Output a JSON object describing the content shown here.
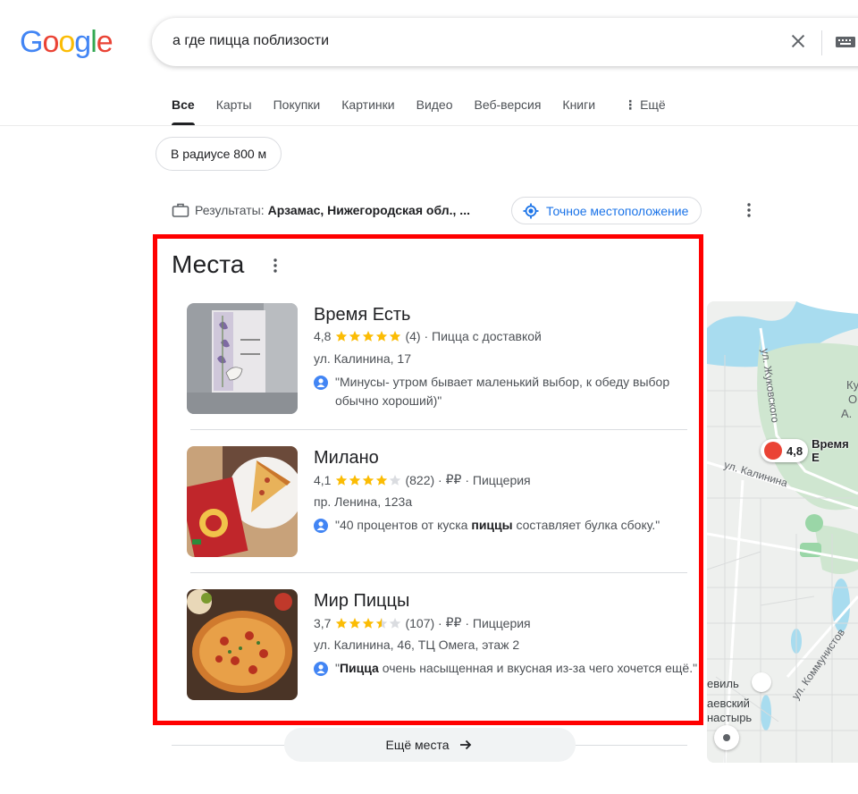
{
  "logo": {
    "text": [
      "G",
      "o",
      "o",
      "g",
      "l",
      "e"
    ],
    "colors": [
      "#4285f4",
      "#ea4335",
      "#fbbc05",
      "#4285f4",
      "#34a853",
      "#ea4335"
    ]
  },
  "search": {
    "query": "а где пицца поблизости"
  },
  "tabs": [
    {
      "label": "Все",
      "active": true
    },
    {
      "label": "Карты"
    },
    {
      "label": "Покупки"
    },
    {
      "label": "Картинки"
    },
    {
      "label": "Видео"
    },
    {
      "label": "Веб-версия"
    },
    {
      "label": "Книги"
    },
    {
      "label": "Ещё",
      "dots": "⋮"
    }
  ],
  "chip": {
    "label": "В радиусе 800 м"
  },
  "location": {
    "prefix": "Результаты:",
    "place": "Арзамас, Нижегородская обл., ...",
    "precise_label": "Точное местоположение"
  },
  "places": {
    "title": "Места",
    "items": [
      {
        "name": "Время Есть",
        "rating": "4,8",
        "stars": 5,
        "count": "(4)",
        "price": "",
        "category": "Пицца с доставкой",
        "address": "ул. Калинина, 17",
        "review_parts": [
          "\"Минусы- утром бывает маленький выбор, к обеду выбор обычно хороший)\""
        ]
      },
      {
        "name": "Милано",
        "rating": "4,1",
        "stars": 4,
        "count": "(822)",
        "price": "₽₽",
        "category": "Пиццерия",
        "address": "пр. Ленина, 123а",
        "review_before": "\"40 процентов от куска ",
        "review_bold": "пиццы",
        "review_after": " составляет булка сбоку.\""
      },
      {
        "name": "Мир Пиццы",
        "rating": "3,7",
        "stars": 3.5,
        "count": "(107)",
        "price": "₽₽",
        "category": "Пиццерия",
        "address": "ул. Калинина, 46, ТЦ Омега, этаж 2",
        "review_before": "\"",
        "review_bold": "Пицца",
        "review_after": " очень насыщенная и вкусная из-за чего хочется ещё.\""
      }
    ],
    "more_label": "Ещё места"
  },
  "map": {
    "pin_rating": "4,8",
    "pin_name": "Время Е",
    "labels": {
      "street1": "ул. Жуковского",
      "street2": "ул. Калинина",
      "street3": "ул. Коммунистов",
      "poi1": "Ку",
      "poi2": "О",
      "poi3": "А.",
      "poi4": "евиль",
      "poi5": "аевский",
      "poi6": "настырь"
    }
  },
  "colors": {
    "accent": "#1a73e8",
    "star": "#fbbc04",
    "frame": "#ff0000"
  }
}
